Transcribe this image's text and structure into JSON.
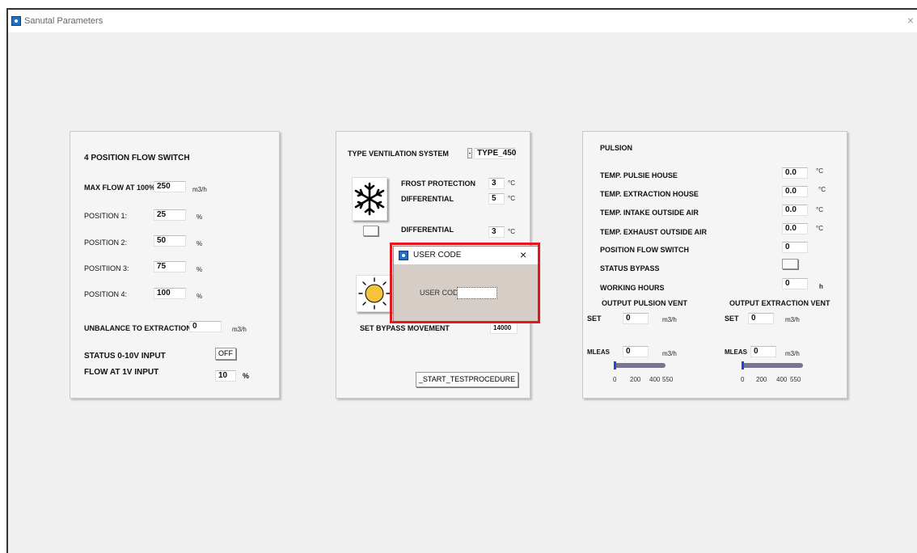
{
  "window": {
    "title": "Sanutal Parameters",
    "close": "×"
  },
  "left": {
    "heading": "4 POSITION FLOW SWITCH",
    "max_flow_label": "MAX FLOW AT 100%",
    "max_flow_value": "250",
    "max_flow_unit": "m3/h",
    "positions": [
      {
        "label": "POSITION 1:",
        "value": "25",
        "unit": "%"
      },
      {
        "label": "POSITION 2:",
        "value": "50",
        "unit": "%"
      },
      {
        "label": "POSITIION 3:",
        "value": "75",
        "unit": "%"
      },
      {
        "label": "POSITION 4:",
        "value": "100",
        "unit": "%"
      }
    ],
    "unbalance_label": "UNBALANCE TO EXTRACTION",
    "unbalance_value": "0",
    "unbalance_unit": "m3/h",
    "status_label": "STATUS 0-10V INPUT",
    "status_button": "OFF",
    "flow1v_label": "FLOW AT 1V INPUT",
    "flow1v_value": "10",
    "flow1v_unit": "%"
  },
  "middle": {
    "type_label": "TYPE VENTILATION SYSTEM",
    "type_value": "TYPE_450",
    "frost_label": "FROST PROTECTION",
    "frost_value": "3",
    "frost_unit": "°C",
    "diff1_label": "DIFFERENTIAL",
    "diff1_value": "5",
    "diff1_unit": "°C",
    "diff2_label": "DIFFERENTIAL",
    "diff2_value": "3",
    "diff2_unit": "°C",
    "bypass_label": "SET BYPASS MOVEMENT",
    "bypass_value": "14000",
    "test_button": "_START_TESTPROCEDURE",
    "snow_icon": "snowflake-icon",
    "sun_icon": "sun-icon"
  },
  "right": {
    "heading": "PULSION",
    "temps": [
      {
        "label": "TEMP. PULSIE HOUSE",
        "value": "0.0",
        "unit": "°C"
      },
      {
        "label": "TEMP. EXTRACTION HOUSE",
        "value": "0.0",
        "unit": "°C"
      },
      {
        "label": "TEMP. INTAKE OUTSIDE AIR",
        "value": "0.0",
        "unit": "°C"
      },
      {
        "label": "TEMP. EXHAUST OUTSIDE AIR",
        "value": "0.0",
        "unit": "°C"
      }
    ],
    "position_label": "POSITION FLOW SWITCH",
    "position_value": "0",
    "bypass_label": "STATUS BYPASS",
    "hours_label": "WORKING HOURS",
    "hours_value": "0",
    "hours_unit": "h",
    "out_pulsion_label": "OUTPUT PULSION VENT",
    "out_extraction_label": "OUTPUT EXTRACTION VENT",
    "set_label": "SET",
    "set1_value": "0",
    "set2_value": "0",
    "set_unit": "m3/h",
    "meas_label": "MLEAS",
    "meas1_value": "0",
    "meas2_value": "0",
    "meas_unit": "m3/h",
    "ticks": [
      "0",
      "200",
      "400",
      "550"
    ],
    "slider1_value": 0,
    "slider2_value": 0
  },
  "dialog": {
    "title": "USER CODE",
    "field_label": "USER COD",
    "field_value": "",
    "close": "×"
  }
}
